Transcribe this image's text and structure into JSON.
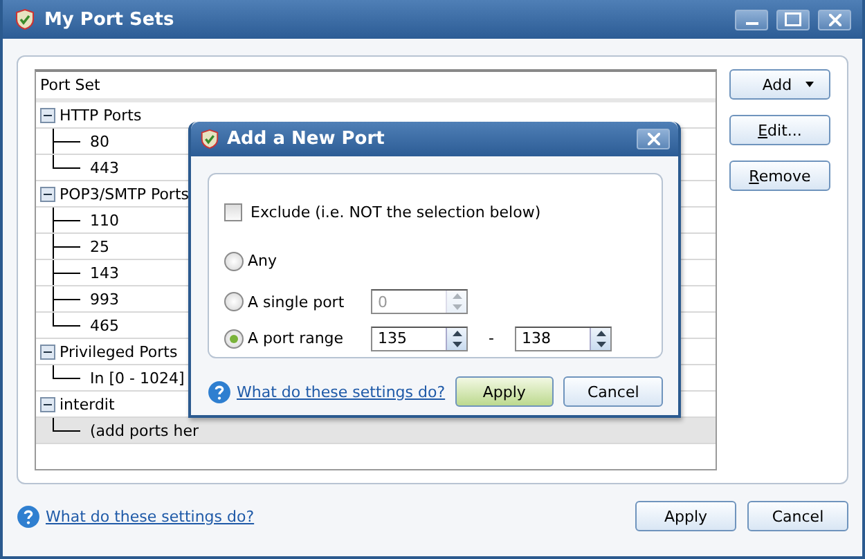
{
  "window": {
    "title": "My Port Sets"
  },
  "tree": {
    "header": "Port Set",
    "items": [
      {
        "label": "HTTP Ports",
        "expanded": true,
        "selected": false,
        "children": [
          {
            "label": "80",
            "selected": false
          },
          {
            "label": "443",
            "selected": false
          }
        ]
      },
      {
        "label": "POP3/SMTP Ports",
        "expanded": true,
        "selected": false,
        "children": [
          {
            "label": "110",
            "selected": false
          },
          {
            "label": "25",
            "selected": false
          },
          {
            "label": "143",
            "selected": false
          },
          {
            "label": "993",
            "selected": false
          },
          {
            "label": "465",
            "selected": false
          }
        ]
      },
      {
        "label": "Privileged Ports",
        "expanded": true,
        "selected": false,
        "children": [
          {
            "label": "In [0 - 1024]",
            "selected": false
          }
        ]
      },
      {
        "label": "interdit",
        "expanded": true,
        "selected": false,
        "children": [
          {
            "label": "(add ports her",
            "selected": true
          }
        ]
      }
    ]
  },
  "side_buttons": [
    {
      "label": "Add",
      "kind": "dropdown"
    },
    {
      "label": "Edit...",
      "kind": "plain"
    },
    {
      "label": "Remove",
      "kind": "plain"
    }
  ],
  "help_link": "What do these settings do?",
  "footer_buttons": [
    {
      "label": "Apply"
    },
    {
      "label": "Cancel"
    }
  ],
  "dialog": {
    "title": "Add a New Port",
    "exclude": {
      "label": "Exclude (i.e. NOT the selection below)",
      "checked": false
    },
    "options": [
      {
        "label": "Any",
        "selected": false,
        "kind": "none"
      },
      {
        "label": "A single port",
        "selected": false,
        "kind": "single",
        "value": "0"
      },
      {
        "label": "A port range",
        "selected": true,
        "kind": "range",
        "from": "135",
        "separator": "-",
        "to": "138"
      }
    ],
    "help_link": "What do these settings do?",
    "buttons": [
      {
        "label": "Apply",
        "kind": "primary"
      },
      {
        "label": "Cancel",
        "kind": "plain"
      }
    ]
  }
}
